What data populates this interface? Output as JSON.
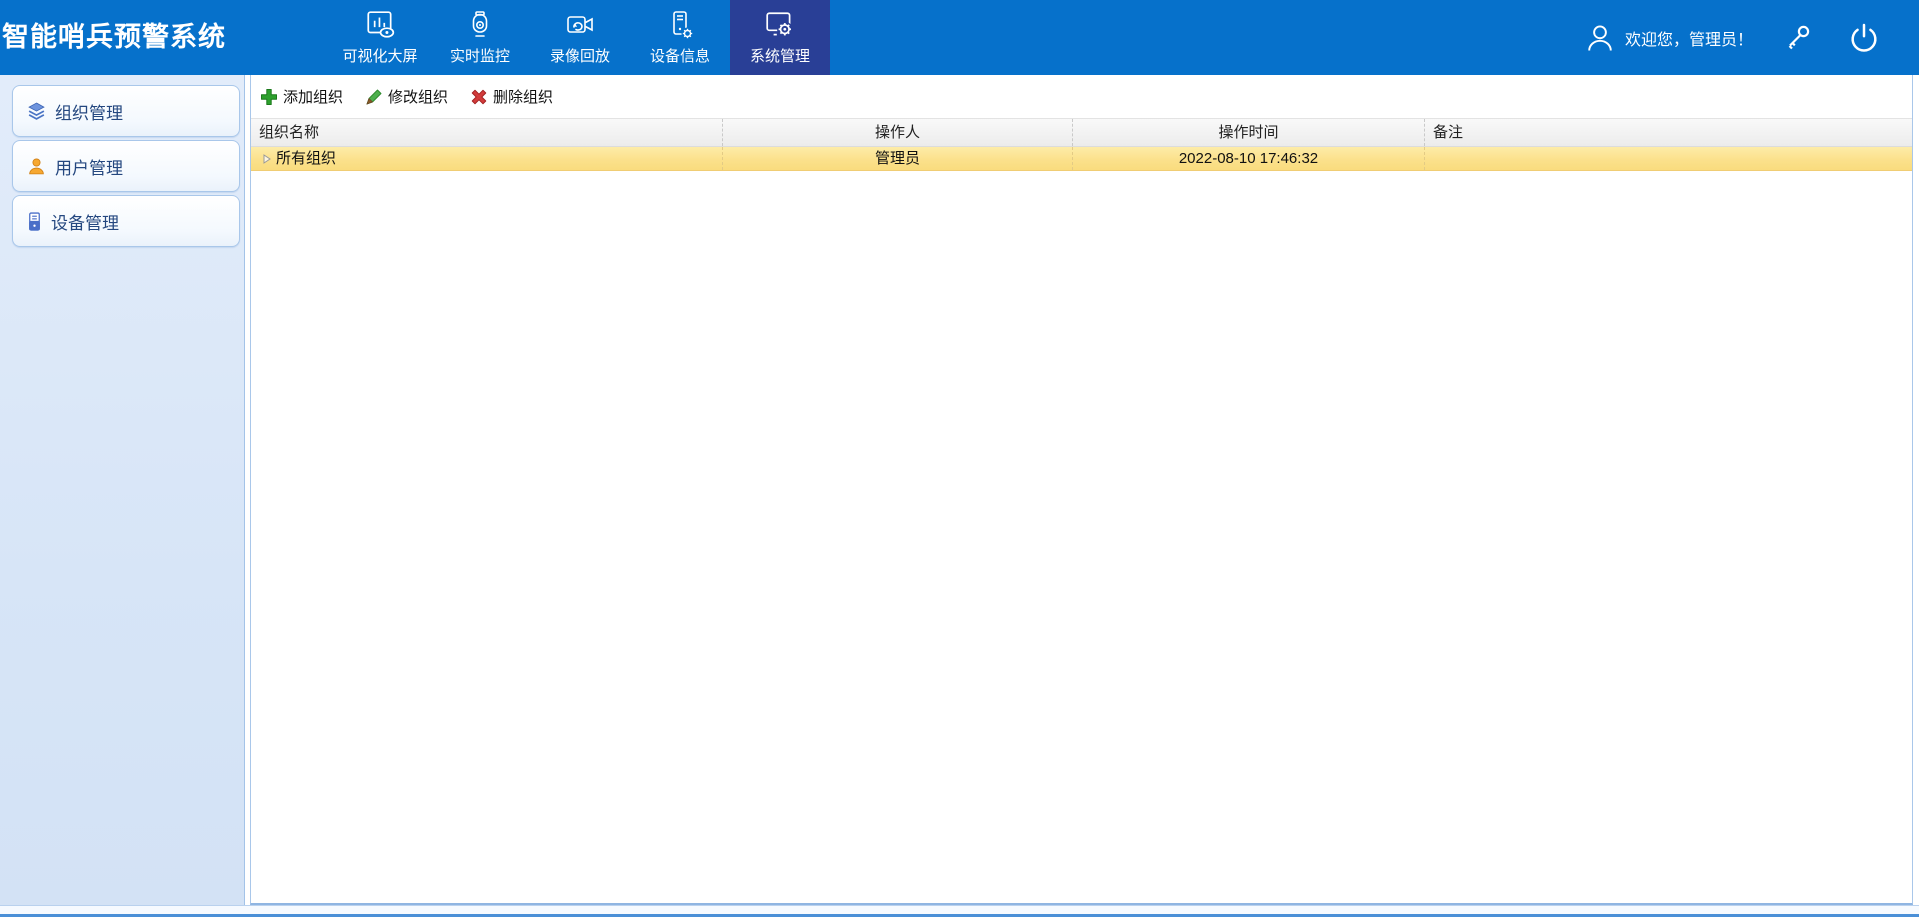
{
  "app": {
    "title": "智能哨兵预警系统"
  },
  "nav": {
    "items": [
      {
        "label": "可视化大屏",
        "icon": "dashboard-icon",
        "active": false
      },
      {
        "label": "实时监控",
        "icon": "monitor-camera-icon",
        "active": false
      },
      {
        "label": "录像回放",
        "icon": "video-playback-icon",
        "active": false
      },
      {
        "label": "设备信息",
        "icon": "device-info-icon",
        "active": false
      },
      {
        "label": "系统管理",
        "icon": "system-settings-icon",
        "active": true
      }
    ],
    "welcome_text": "欢迎您，管理员！"
  },
  "sidebar": {
    "items": [
      {
        "label": "组织管理",
        "icon": "organization-icon"
      },
      {
        "label": "用户管理",
        "icon": "user-icon"
      },
      {
        "label": "设备管理",
        "icon": "device-icon"
      }
    ]
  },
  "toolbar": {
    "add_label": "添加组织",
    "edit_label": "修改组织",
    "delete_label": "删除组织"
  },
  "table": {
    "columns": [
      "组织名称",
      "操作人",
      "操作时间",
      "备注"
    ],
    "rows": [
      {
        "name": "所有组织",
        "operator": "管理员",
        "time": "2022-08-10 17:46:32",
        "remark": ""
      }
    ]
  },
  "colors": {
    "nav_bar": "#0671cb",
    "nav_active_tab": "#293f96",
    "row_highlight": "#fbe18c",
    "sidebar_bg": "#d7e5f7",
    "add_green": "#2da02d",
    "delete_red": "#d23b3b"
  }
}
